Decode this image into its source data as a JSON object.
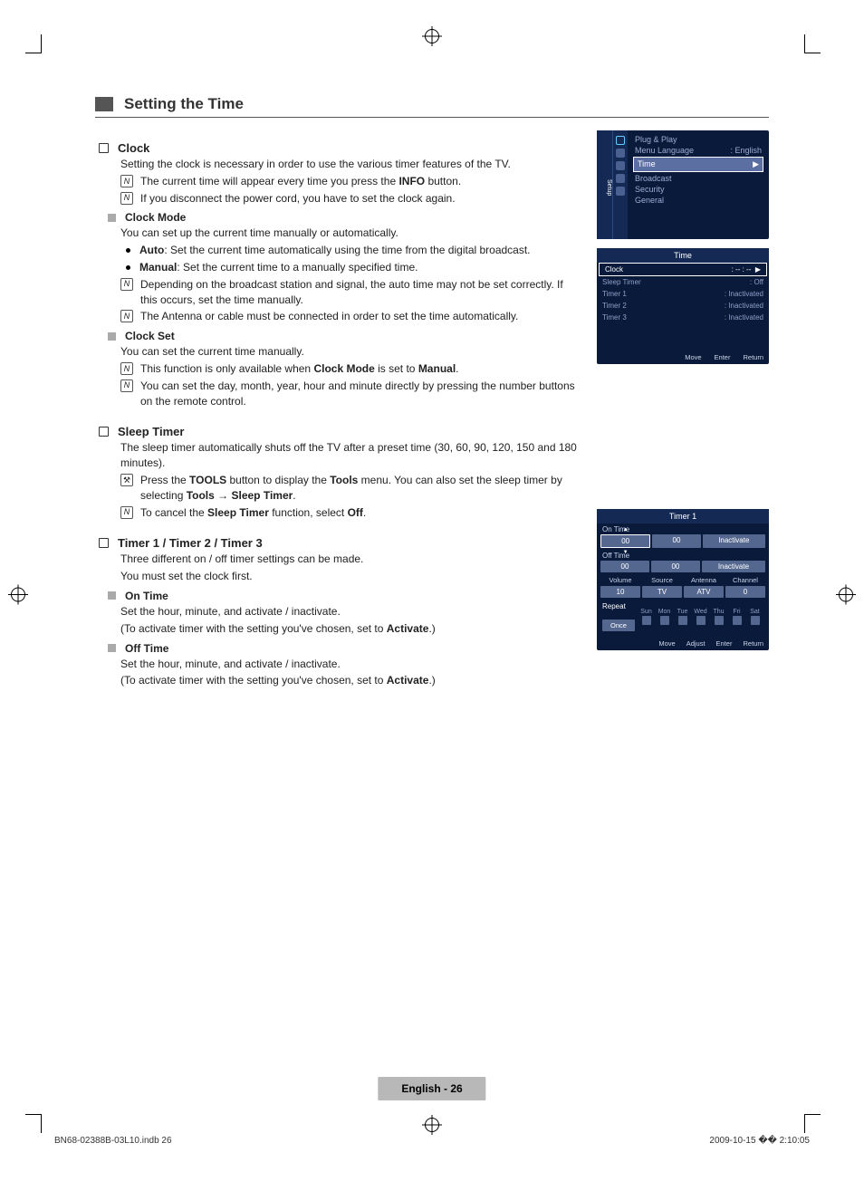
{
  "section_title": "Setting the Time",
  "clock": {
    "title": "Clock",
    "intro": "Setting the clock is necessary in order to use the various timer features of the TV.",
    "note1_pre": "The current time will appear every time you press the ",
    "note1_bold": "INFO",
    "note1_post": " button.",
    "note2": "If you disconnect the power cord, you have to set the clock again.",
    "mode": {
      "title": "Clock Mode",
      "intro": "You can set up the current time manually or automatically.",
      "auto_label": "Auto",
      "auto_text": ": Set the current time automatically using the time from the digital broadcast.",
      "manual_label": "Manual",
      "manual_text": ": Set the current time to a manually specified time.",
      "note1": "Depending on the broadcast station and signal, the auto time may not be set correctly. If this occurs, set the time manually.",
      "note2": "The Antenna or cable must be connected in order to set the time automatically."
    },
    "set": {
      "title": "Clock Set",
      "intro": "You can set the current time manually.",
      "note1_pre": "This function is only available when ",
      "note1_b1": "Clock Mode",
      "note1_mid": " is set to ",
      "note1_b2": "Manual",
      "note1_post": ".",
      "note2": "You can set the day, month, year, hour and minute directly by pressing the number buttons on the remote control."
    }
  },
  "sleep": {
    "title": "Sleep Timer",
    "intro": "The sleep timer automatically shuts off the TV after a preset time (30, 60, 90, 120, 150 and 180 minutes).",
    "tools_pre": "Press the ",
    "tools_b1": "TOOLS",
    "tools_mid": " button to display the ",
    "tools_b2": "Tools",
    "tools_mid2": " menu. You can also set the sleep timer by selecting ",
    "tools_b3": "Tools",
    "tools_arrow": " → ",
    "tools_b4": "Sleep Timer",
    "tools_post": ".",
    "cancel_pre": "To cancel the ",
    "cancel_b1": "Sleep Timer",
    "cancel_mid": " function, select ",
    "cancel_b2": "Off",
    "cancel_post": "."
  },
  "timers": {
    "title": "Timer 1 / Timer 2 / Timer 3",
    "intro1": "Three different on / off timer settings can be made.",
    "intro2": "You must set the clock first.",
    "on": {
      "title": "On Time",
      "l1": "Set the hour, minute, and activate / inactivate.",
      "l2_pre": "(To activate timer with the setting you've chosen, set to ",
      "l2_b": "Activate",
      "l2_post": ".)"
    },
    "off": {
      "title": "Off Time",
      "l1": "Set the hour, minute, and activate / inactivate.",
      "l2_pre": "(To activate timer with the setting you've chosen, set to ",
      "l2_b": "Activate",
      "l2_post": ".)"
    }
  },
  "osd1": {
    "side": "Setup",
    "plugplay": "Plug & Play",
    "menulang": "Menu Language",
    "menulang_val": ": English",
    "time": "Time",
    "broadcast": "Broadcast",
    "security": "Security",
    "general": "General"
  },
  "osd2": {
    "title": "Time",
    "clock": "Clock",
    "clock_v": ": -- : --",
    "sleep": "Sleep Timer",
    "sleep_v": ": Off",
    "t1": "Timer 1",
    "t1_v": ": Inactivated",
    "t2": "Timer 2",
    "t2_v": ": Inactivated",
    "t3": "Timer 3",
    "t3_v": ": Inactivated",
    "move": "Move",
    "enter": "Enter",
    "return": "Return"
  },
  "osd3": {
    "title": "Timer 1",
    "ontime": "On Time",
    "offtime": "Off Time",
    "h00": "00",
    "m00": "00",
    "inact": "Inactivate",
    "vol": "Volume",
    "src": "Source",
    "ant": "Antenna",
    "ch": "Channel",
    "v10": "10",
    "vtv": "TV",
    "vatv": "ATV",
    "v0": "0",
    "repeat": "Repeat",
    "once": "Once",
    "sun": "Sun",
    "mon": "Mon",
    "tue": "Tue",
    "wed": "Wed",
    "thu": "Thu",
    "fri": "Fri",
    "sat": "Sat",
    "move": "Move",
    "adjust": "Adjust",
    "enter": "Enter",
    "return": "Return"
  },
  "footer": {
    "page": "English - 26",
    "doc": "BN68-02388B-03L10.indb   26",
    "date": "2009-10-15   �� 2:10:05"
  }
}
